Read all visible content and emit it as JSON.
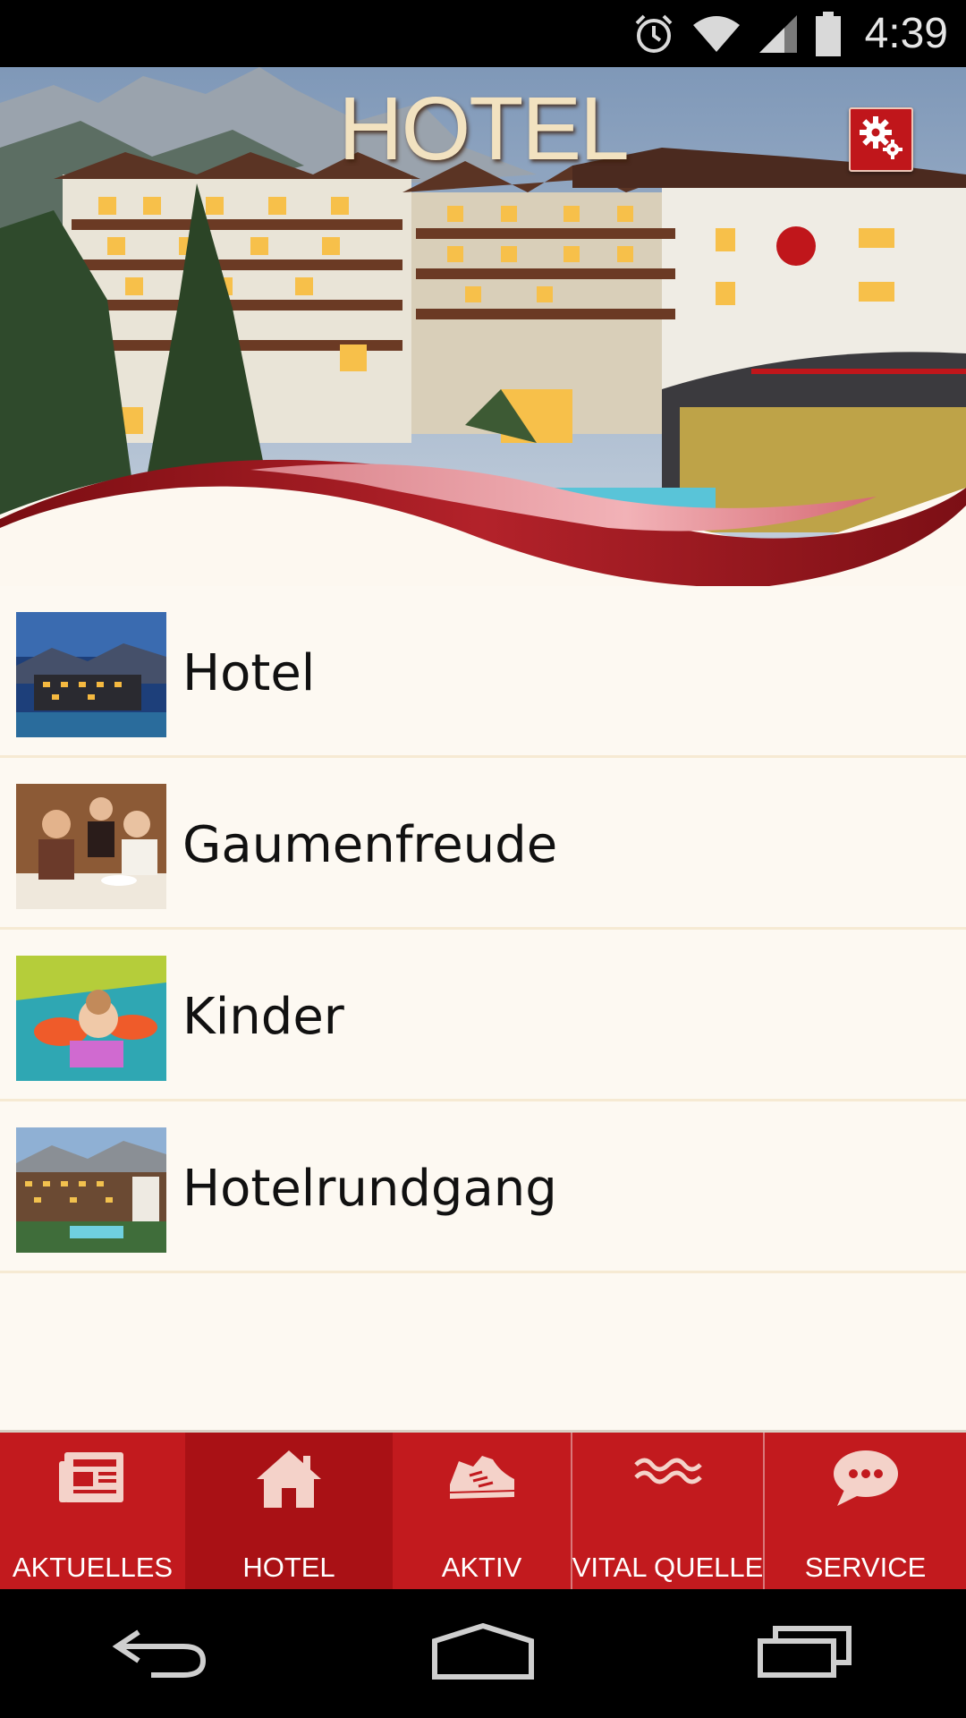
{
  "status_bar": {
    "time": "4:39",
    "icons": [
      "alarm-icon",
      "wifi-icon",
      "signal-icon",
      "battery-icon"
    ]
  },
  "header": {
    "title": "HOTEL",
    "settings_icon": "gear-icon",
    "accent_color": "#c0161b"
  },
  "menu": {
    "items": [
      {
        "label": "Hotel",
        "thumb": "hotel-night-photo"
      },
      {
        "label": "Gaumenfreude",
        "thumb": "dining-photo"
      },
      {
        "label": "Kinder",
        "thumb": "child-pool-photo"
      },
      {
        "label": "Hotelrundgang",
        "thumb": "hotel-exterior-photo"
      }
    ]
  },
  "bottom_nav": {
    "tabs": [
      {
        "label": "AKTUELLES",
        "icon": "newspaper-icon"
      },
      {
        "label": "HOTEL",
        "icon": "house-icon",
        "active": true
      },
      {
        "label": "AKTIV",
        "icon": "sneaker-icon"
      },
      {
        "label": "VITAL QUELLE",
        "icon": "waves-icon"
      },
      {
        "label": "SERVICE",
        "icon": "chat-bubble-icon"
      }
    ],
    "background": "#c21a1e"
  },
  "system_nav": {
    "buttons": [
      "back-icon",
      "home-icon",
      "recents-icon"
    ]
  }
}
